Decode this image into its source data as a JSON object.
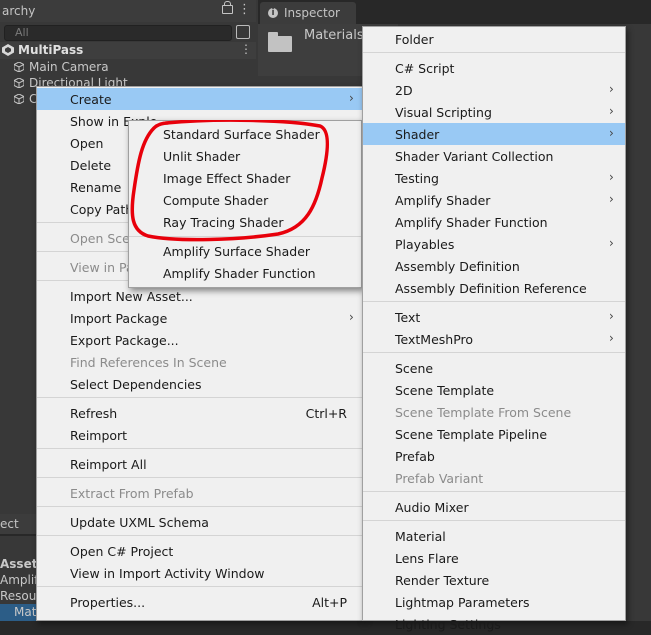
{
  "hierarchy": {
    "tab_label": "archy",
    "search_placeholder": "All",
    "scene_name": "MultiPass",
    "items": [
      "Main Camera",
      "Directional Light",
      "C"
    ]
  },
  "inspector": {
    "tab_label": "Inspector",
    "header_title": "Materials"
  },
  "project": {
    "tab_label": "ect",
    "assets_label": "Assets",
    "items": [
      "Amplif",
      "Resou",
      "Mate"
    ]
  },
  "main_menu": {
    "items": [
      {
        "label": "Create",
        "submenu": true,
        "highlighted": true
      },
      {
        "label": "Show in Explo"
      },
      {
        "label": "Open"
      },
      {
        "label": "Delete"
      },
      {
        "label": "Rename"
      },
      {
        "label": "Copy Path"
      },
      {
        "label": "Open Scen",
        "disabled": true
      },
      {
        "label": "View in Pa",
        "disabled": true
      },
      {
        "label": "Import New Asset..."
      },
      {
        "label": "Import Package",
        "submenu": true
      },
      {
        "label": "Export Package..."
      },
      {
        "label": "Find References In Scene",
        "disabled": true
      },
      {
        "label": "Select Dependencies"
      },
      {
        "label": "Refresh",
        "shortcut": "Ctrl+R"
      },
      {
        "label": "Reimport"
      },
      {
        "label": "Reimport All"
      },
      {
        "label": "Extract From Prefab",
        "disabled": true
      },
      {
        "label": "Update UXML Schema"
      },
      {
        "label": "Open C# Project"
      },
      {
        "label": "View in Import Activity Window"
      },
      {
        "label": "Properties...",
        "shortcut": "Alt+P"
      }
    ]
  },
  "shader_menu": {
    "items": [
      {
        "label": "Standard Surface Shader"
      },
      {
        "label": "Unlit Shader"
      },
      {
        "label": "Image Effect Shader"
      },
      {
        "label": "Compute Shader"
      },
      {
        "label": "Ray Tracing Shader"
      },
      {
        "label": "Amplify Surface Shader"
      },
      {
        "label": "Amplify Shader Function"
      }
    ]
  },
  "create_menu": {
    "items": [
      {
        "label": "Folder"
      },
      {
        "label": "C# Script"
      },
      {
        "label": "2D",
        "submenu": true
      },
      {
        "label": "Visual Scripting",
        "submenu": true
      },
      {
        "label": "Shader",
        "submenu": true,
        "highlighted": true
      },
      {
        "label": "Shader Variant Collection"
      },
      {
        "label": "Testing",
        "submenu": true
      },
      {
        "label": "Amplify Shader",
        "submenu": true
      },
      {
        "label": "Amplify Shader Function"
      },
      {
        "label": "Playables",
        "submenu": true
      },
      {
        "label": "Assembly Definition"
      },
      {
        "label": "Assembly Definition Reference"
      },
      {
        "label": "Text",
        "submenu": true
      },
      {
        "label": "TextMeshPro",
        "submenu": true
      },
      {
        "label": "Scene"
      },
      {
        "label": "Scene Template"
      },
      {
        "label": "Scene Template From Scene",
        "disabled": true
      },
      {
        "label": "Scene Template Pipeline"
      },
      {
        "label": "Prefab"
      },
      {
        "label": "Prefab Variant",
        "disabled": true
      },
      {
        "label": "Audio Mixer"
      },
      {
        "label": "Material"
      },
      {
        "label": "Lens Flare"
      },
      {
        "label": "Render Texture"
      },
      {
        "label": "Lightmap Parameters"
      },
      {
        "label": "Lighting Settings"
      }
    ]
  },
  "colors": {
    "highlight": "#99c9f4",
    "menu_bg": "#f0f0f0",
    "annotation": "#e8000b"
  }
}
